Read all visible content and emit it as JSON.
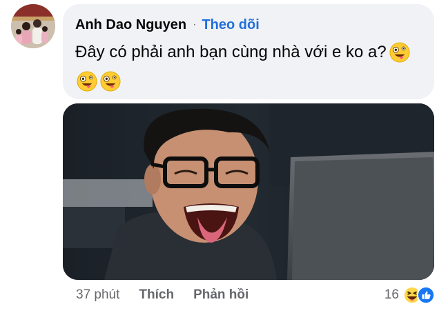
{
  "comment": {
    "author": "Anh Dao Nguyen",
    "separator": "·",
    "follow_label": "Theo dõi",
    "text": "Đây có phải anh bạn cùng nhà với e ko a?",
    "inline_emoji": "zany-face-emoji",
    "trailing_emojis": [
      "zany-face-emoji",
      "zany-face-emoji"
    ]
  },
  "footer": {
    "time": "37 phút",
    "like_label": "Thích",
    "reply_label": "Phản hồi",
    "reaction_count": "16",
    "reaction_icons": [
      "haha-reaction-icon",
      "like-reaction-icon"
    ]
  },
  "colors": {
    "bubble": "#f0f2f5",
    "follow": "#216fdb",
    "muted": "#65676b",
    "like_blue": "#1877f2"
  }
}
